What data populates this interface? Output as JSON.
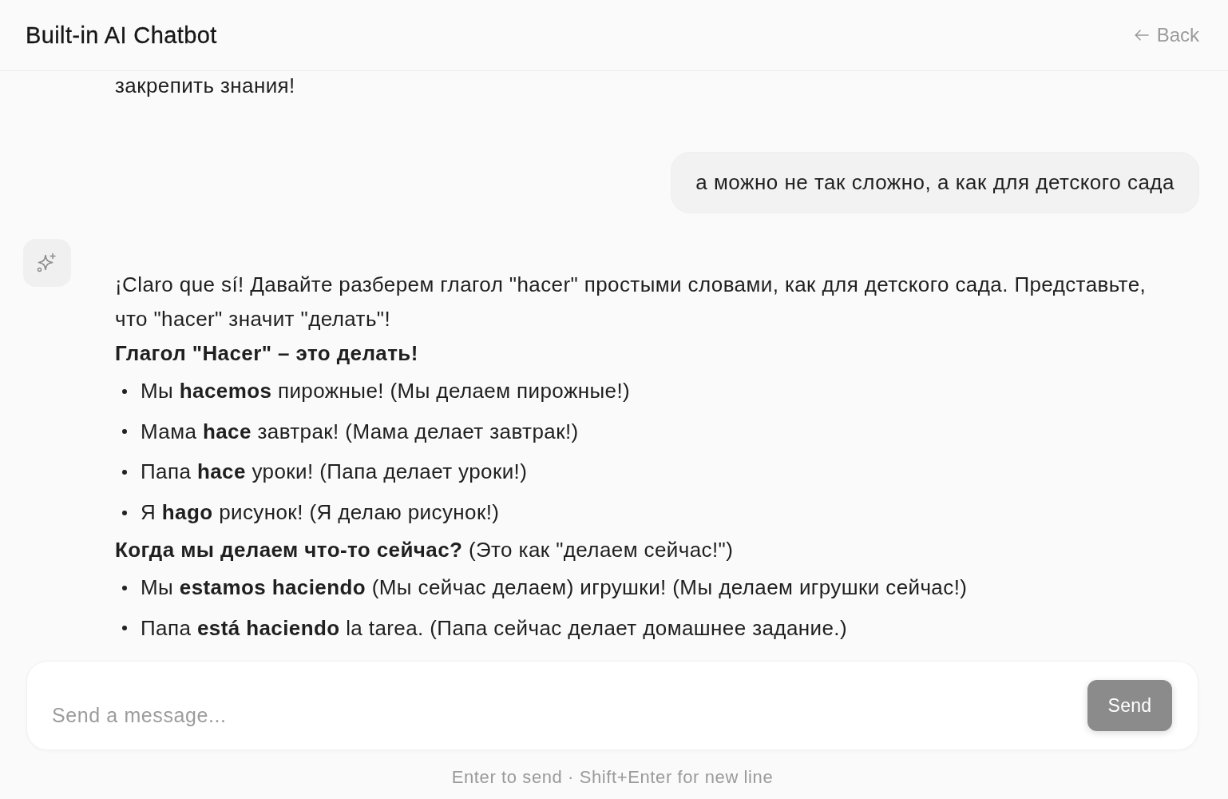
{
  "header": {
    "title": "Built-in AI Chatbot",
    "back_label": "Back"
  },
  "messages": [
    {
      "kind": "assistant",
      "avatar": false,
      "blocks": [
        {
          "kind": "paragraph",
          "text": "закрепить знания!"
        }
      ]
    },
    {
      "kind": "user",
      "text": "а можно не так сложно, а как для детского сада"
    },
    {
      "kind": "assistant",
      "avatar": true,
      "blocks": [
        {
          "kind": "paragraph",
          "text": "¡Claro que sí! Давайте разберем глагол \"hacer\" простыми словами, как для детского сада. Представьте, что \"hacer\" значит \"делать\"!"
        },
        {
          "kind": "heading",
          "text": "Глагол \"Hacer\" – это делать!"
        },
        {
          "kind": "list",
          "items": [
            "Мы **hacemos** пирожные! (Мы делаем пирожные!)",
            "Мама **hace** завтрак! (Мама делает завтрак!)",
            "Папа **hace** уроки! (Папа делает уроки!)",
            "Я **hago** рисунок! (Я делаю рисунок!)"
          ]
        },
        {
          "kind": "paragraph",
          "text": "**Когда мы делаем что-то сейчас?** (Это как \"делаем сейчас!\")"
        },
        {
          "kind": "list",
          "items": [
            "Мы **estamos haciendo** (Мы сейчас делаем) игрушки! (Мы делаем игрушки сейчас!)",
            "Папа **está haciendo** la tarea. (Папа сейчас делает домашнее задание.)"
          ]
        }
      ]
    }
  ],
  "composer": {
    "placeholder": "Send a message...",
    "send_button": {
      "label": "Send",
      "disabled": true
    },
    "hint": "Enter to send · Shift+Enter for new line"
  }
}
